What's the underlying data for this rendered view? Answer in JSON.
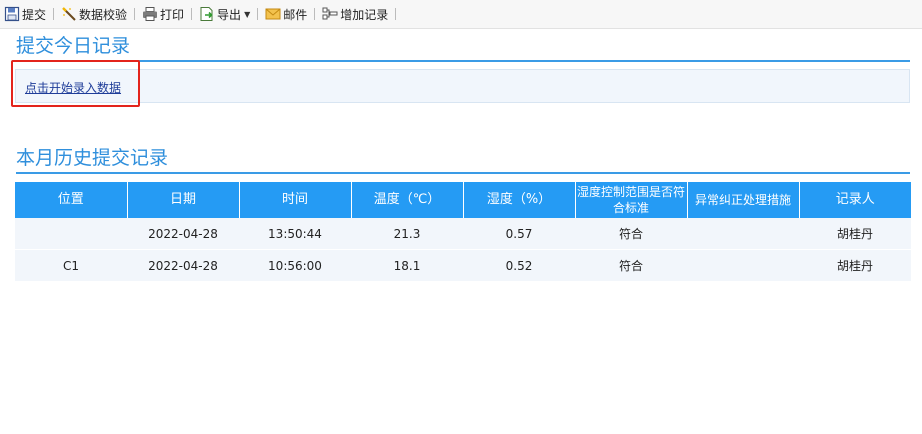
{
  "toolbar": {
    "submit": "提交",
    "validate": "数据校验",
    "print": "打印",
    "export": "导出",
    "mail": "邮件",
    "add_record": "增加记录"
  },
  "today_section": {
    "title": "提交今日记录",
    "start_link": "点击开始录入数据"
  },
  "history_section": {
    "title": "本月历史提交记录",
    "columns": [
      "位置",
      "日期",
      "时间",
      "温度（℃）",
      "湿度（%）",
      "湿度控制范围是否符合标准",
      "异常纠正处理措施",
      "记录人"
    ],
    "rows": [
      [
        "",
        "2022-04-28",
        "13:50:44",
        "21.3",
        "0.57",
        "符合",
        "",
        "胡桂丹"
      ],
      [
        "C1",
        "2022-04-28",
        "10:56:00",
        "18.1",
        "0.52",
        "符合",
        "",
        "胡桂丹"
      ]
    ]
  },
  "colors": {
    "accent": "#2f8fdc",
    "header_bg": "#259bf4",
    "row_bg": "#f2f6fb",
    "highlight": "#e3241c"
  }
}
